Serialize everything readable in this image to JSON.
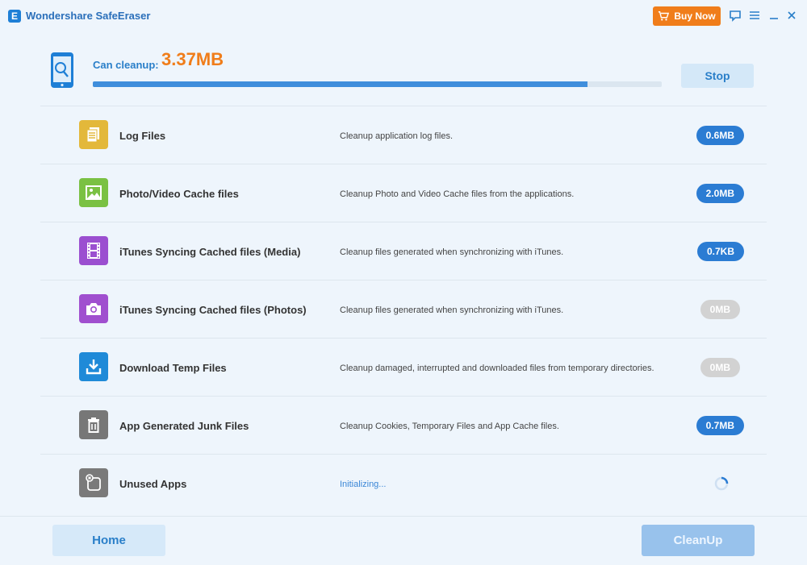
{
  "window": {
    "title": "Wondershare SafeEraser",
    "logo_letter": "E",
    "buy_label": "Buy Now"
  },
  "summary": {
    "can_cleanup_label": "Can cleanup:",
    "can_cleanup_value": "3.37MB",
    "progress_percent": 87,
    "stop_label": "Stop"
  },
  "items": [
    {
      "name": "Log Files",
      "description": "Cleanup application log files.",
      "size": "0.6MB",
      "state": "active",
      "icon": "log-files-icon",
      "color": "#e3b83a"
    },
    {
      "name": "Photo/Video Cache files",
      "description": "Cleanup Photo and Video Cache files from the applications.",
      "size": "2.0MB",
      "state": "active",
      "icon": "photo-video-icon",
      "color": "#7ac143"
    },
    {
      "name": "iTunes Syncing Cached files (Media)",
      "description": "Cleanup files generated when synchronizing with iTunes.",
      "size": "0.7KB",
      "state": "active",
      "icon": "film-icon",
      "color": "#9b4fd0"
    },
    {
      "name": "iTunes Syncing Cached files (Photos)",
      "description": "Cleanup files generated when synchronizing with iTunes.",
      "size": "0MB",
      "state": "inactive",
      "icon": "camera-icon",
      "color": "#a04fcf"
    },
    {
      "name": "Download Temp Files",
      "description": "Cleanup damaged, interrupted and downloaded files from temporary directories.",
      "size": "0MB",
      "state": "inactive",
      "icon": "download-icon",
      "color": "#1f8ad8"
    },
    {
      "name": "App Generated Junk Files",
      "description": "Cleanup Cookies, Temporary Files and App Cache files.",
      "size": "0.7MB",
      "state": "active",
      "icon": "trash-icon",
      "color": "#777777"
    },
    {
      "name": "Unused Apps",
      "description": "Initializing...",
      "size": "",
      "state": "loading",
      "icon": "unused-apps-icon",
      "color": "#7a7a7a"
    }
  ],
  "footer": {
    "home_label": "Home",
    "cleanup_label": "CleanUp"
  },
  "colors": {
    "accent": "#2b7cd3",
    "orange": "#f07d1a",
    "background": "#eef5fc"
  }
}
